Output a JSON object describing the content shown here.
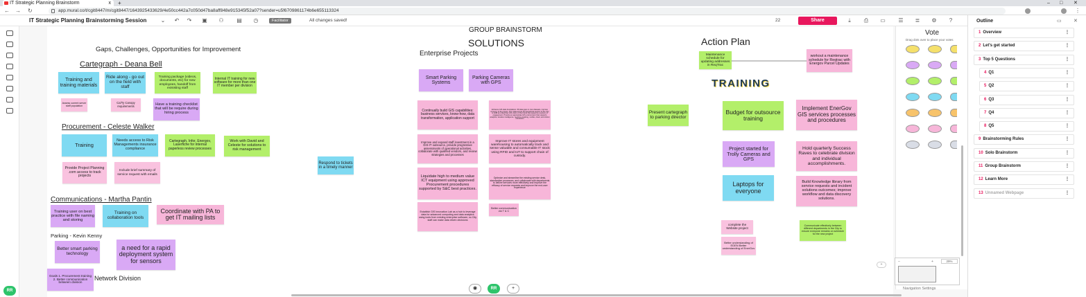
{
  "browser": {
    "tab_title": "IT Strategic Planning Brainstorm",
    "tab_close": "x",
    "new_tab": "+",
    "url": "app.mural.co/t/cgit8447/m/cgit8447/1643925433629/4e50cc442a7c050d47ba8aff848e915345f52a07?sender=u5f6709861174b6e655113324",
    "window_controls": [
      "–",
      "□",
      "✕"
    ]
  },
  "toolbar": {
    "title": "IT Strategic Planning Brainstorming Session",
    "facilitator": "Facilitator",
    "saved": "All changes saved!",
    "people_count": "22",
    "share_label": "Share"
  },
  "canvas": {
    "group_brainstorm": "GROUP BRAINSTORM",
    "gaps_heading": "Gaps, Challenges, Opportunities for Improvement",
    "solutions_heading": "SOLUTIONS",
    "enterprise_projects": "Enterprise Projects",
    "action_plan": "Action Plan",
    "training_heading": "TRAINING",
    "cartegraph": {
      "heading": "Cartegraph - Deana Bell",
      "notes": [
        "Training and training materials",
        "Ride along - go out on the field with staff",
        "Training package (videos, documents, etc) for new employees, handoff from exisisting staff",
        "Internal IT training for new software for more than one IT member per division",
        "Assess current server staff population",
        "Ca/Ty Canopy requirements",
        "Have a training checklist that will be require during hiring process"
      ]
    },
    "procurement": {
      "heading": "Procurement - Celeste Walker",
      "notes": [
        "Training",
        "Needs access to Risk Managements insurance compliance",
        "Cartegraph, Infor, Energov, Laserfiche for internal paperless review processes",
        "Work with David and Celeste for solutions to risk management",
        "Provide Project Planning .com access to track projects",
        "Include brief summary of service request with emails"
      ]
    },
    "respond_note": "Respond to tickets in a timely manner",
    "communications": {
      "heading": "Communications - Martha Pantin",
      "notes": [
        "Training user on best practice with file naming and storing",
        "Training on collaboration tools",
        "Coordinate with PA to get IT mailing lists"
      ]
    },
    "parking": {
      "heading": "Parking - Kevin Kenny",
      "notes": [
        "Better smart parking technology",
        "a need for a rapid deployment system for sensors"
      ]
    },
    "network": {
      "heading": "Network Division",
      "goals_note": "Goals 1. Procurement training 2. Better communication between division"
    },
    "solutions_notes": [
      "Smart Parking Systems",
      "Parking Cameras with GPS",
      "Continually build GIS capabilities: business services, know-how, data transformation, application support",
      "Enhance GIS data foundations: fill data gaps in core datasets, improve currency of key layers, fill in data across all operational sectors of the City to fulfill an enterprise GIS vision of the future that supports a system of engagement. Provide an appropriate GIS environment that supports analytics, location intelligence, real-time tracking, mobile, cloud, and citizen interaction",
      "Improve and expand staff investment in a GIS-IT outsource, provide progressive assessments of operational activities, collaborate with qualified vendors, and review strategies and processes",
      "Improve IT stores and equipment warehousing to automatically track and sense valuable and consumable IT stock using RFID and IoT to support chain of custody.",
      "Liquidate high to medium value ICT equipment using approved Procurement procedures supported by S&C best practices.",
      "Optimize and streamline the existing service desk, standardize processes, and collaborate with departments to deliver services more effectively and improve the efficacy of service requests and improve the end-user experience",
      "Establish GIS Innovation Lab as a hub to leverage data for advanced computing and data analytics using tools from existing enterprise software, so City staff can make data driven decisions",
      "Better communication via T & C"
    ],
    "action_notes": [
      "Maintenance schedule for updating addresses in ReqTrac",
      "workout a maintenance schedule for Reqtrac with Energov Parcel Updates",
      "Present cartegraph to parking director",
      "Budget for outsource training",
      "Implement EnerGov GIS services processes and procedures",
      "Project started for Trolly Cameras and GPS",
      "Hold quarterly Success Raves to celebrate division and individual accomplishments.",
      "Laptops for everyone",
      "Build Knowledge library from service requests and incident solutions outcomes; improve workflow and data discovery solutions.",
      "complete the Website project",
      "Better understanding of EDEN Better understanding of EnerGov",
      "Communicate effectively between different departments in the City to ensure everyone remains on schedule for the new project"
    ]
  },
  "vote": {
    "title": "Vote",
    "subtitle": "Drag dots over to place your votes",
    "dot_colors": [
      "#f5e06b",
      "#d9a9f5",
      "#b3ef6a",
      "#7fdaf2",
      "#f7c36b",
      "#f7b6d9",
      "#d9dde6"
    ],
    "zoom": "29%",
    "nav_settings": "Navigation Settings"
  },
  "outline": {
    "title": "Outline",
    "items": [
      {
        "num": "1",
        "name": "Overview"
      },
      {
        "num": "2",
        "name": "Let's get started"
      },
      {
        "num": "3",
        "name": "Top 5 Questions"
      },
      {
        "num": "4",
        "name": "Q1"
      },
      {
        "num": "5",
        "name": "Q2"
      },
      {
        "num": "6",
        "name": "Q3"
      },
      {
        "num": "7",
        "name": "Q4"
      },
      {
        "num": "8",
        "name": "Q5"
      },
      {
        "num": "9",
        "name": "Brainstorming Rules"
      },
      {
        "num": "10",
        "name": "Solo Brainstorm"
      },
      {
        "num": "11",
        "name": "Group Brainstorm"
      },
      {
        "num": "12",
        "name": "Learn More"
      },
      {
        "num": "13",
        "name": "Unnamed Webpage"
      }
    ]
  },
  "user": {
    "initials": "RR"
  },
  "bottom": {
    "add": "+",
    "initials": "RR"
  }
}
